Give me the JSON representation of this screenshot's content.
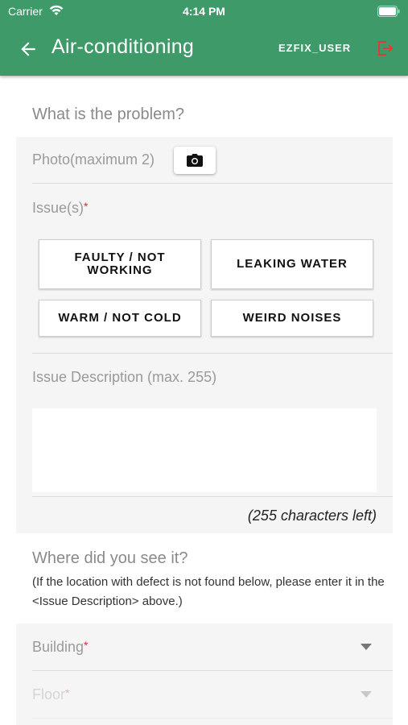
{
  "status_bar": {
    "carrier": "Carrier",
    "time": "4:14 PM"
  },
  "app_bar": {
    "title": "Air-conditioning",
    "user": "EZFIX_USER"
  },
  "problem": {
    "heading": "What is the problem?",
    "photo_label": "Photo(maximum 2)",
    "issues_label": "Issue(s)",
    "required_mark": "*",
    "issues": [
      "FAULTY / NOT WORKING",
      "LEAKING WATER",
      "WARM / NOT COLD",
      "WEIRD NOISES"
    ],
    "description_label": "Issue Description (max. 255)",
    "description_value": "",
    "chars_left": "(255 characters left)"
  },
  "location": {
    "heading": "Where did you see it?",
    "note": "(If the location with defect is not found below, please enter it in the <Issue Description> above.)",
    "building_label": "Building",
    "floor_label": "Floor"
  },
  "colors": {
    "primary": "#3f9a69",
    "logout": "#e53935",
    "required": "#d32f2f"
  }
}
